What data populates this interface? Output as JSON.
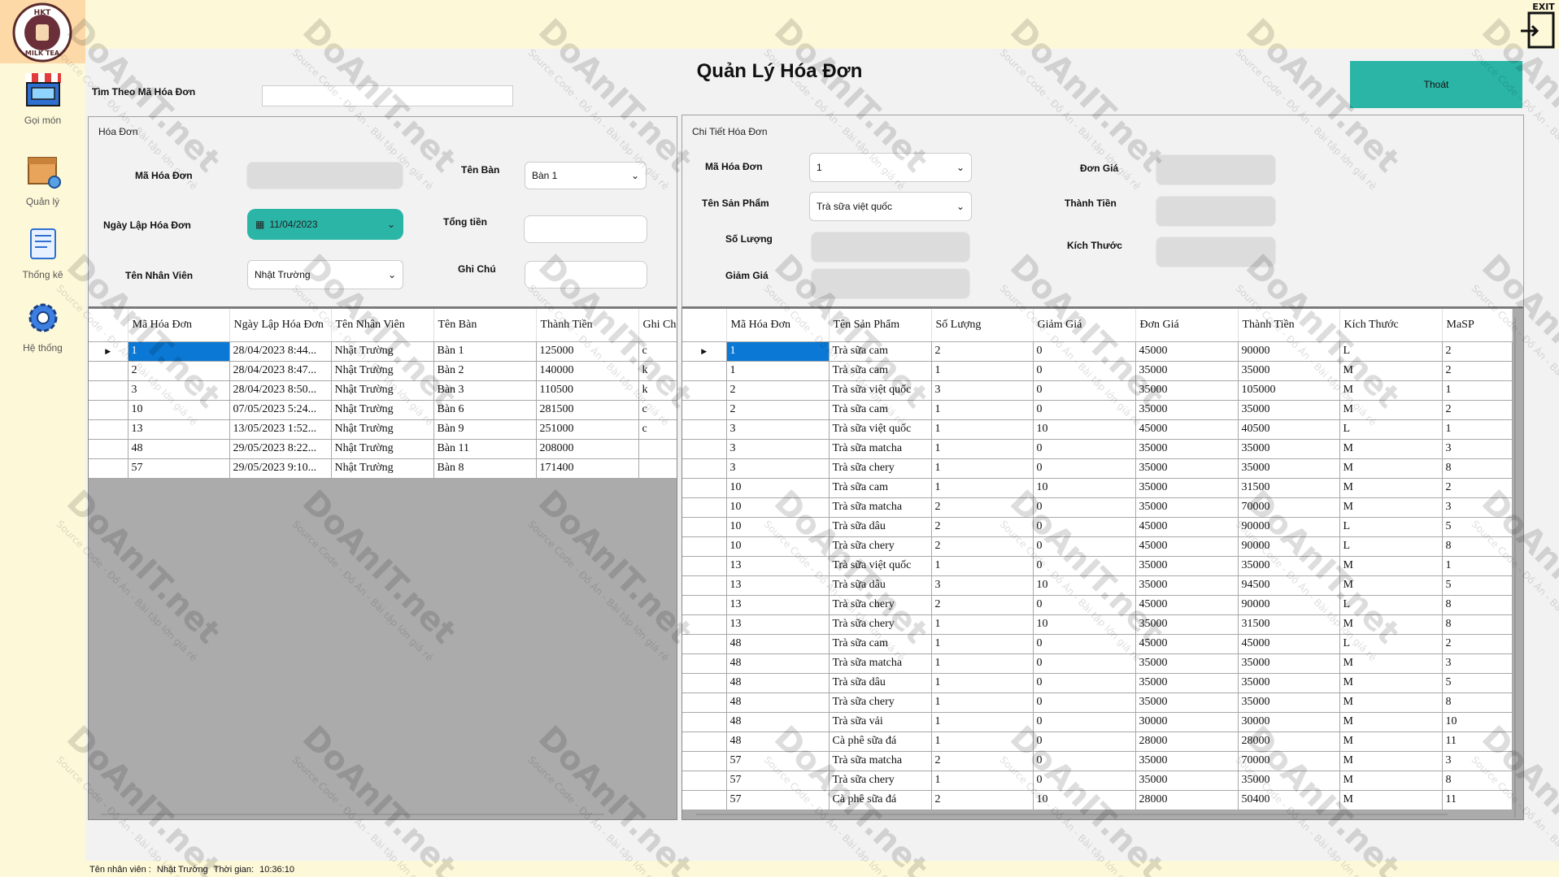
{
  "app": {
    "title": "Quản Lý Hóa Đơn",
    "logo_text": "HKT MILK TEA",
    "exit_icon_label": "EXIT"
  },
  "sidebar": {
    "items": [
      {
        "label": "Gọi món",
        "icon": "shop-icon"
      },
      {
        "label": "Quản lý",
        "icon": "box-gear-icon"
      },
      {
        "label": "Thống kê",
        "icon": "report-icon"
      },
      {
        "label": "Hệ thống",
        "icon": "gear-icon"
      }
    ]
  },
  "search": {
    "label": "Tìm Theo Mã Hóa Đơn",
    "value": ""
  },
  "exit_button": {
    "label": "Thoát"
  },
  "invoice": {
    "group_title": "Hóa Đơn",
    "ma_hoa_don_label": "Mã Hóa Đơn",
    "ma_hoa_don_value": "",
    "ngay_lap_label": "Ngày Lập Hóa Đơn",
    "ngay_lap_value": "11/04/2023",
    "nhan_vien_label": "Tên Nhân Viên",
    "nhan_vien_value": "Nhật Trường",
    "ban_label": "Tên Bàn",
    "ban_value": "Bàn 1",
    "tong_tien_label": "Tổng tiền",
    "tong_tien_value": "",
    "ghi_chu_label": "Ghi Chú",
    "ghi_chu_value": ""
  },
  "detail": {
    "group_title": "Chi Tiết Hóa Đơn",
    "ma_hoa_don_label": "Mã Hóa Đơn",
    "ma_hoa_don_value": "1",
    "san_pham_label": "Tên Sản Phẩm",
    "san_pham_value": "Trà sữa việt quốc",
    "so_luong_label": "Số Lượng",
    "giam_gia_label": "Giảm Giá",
    "don_gia_label": "Đơn Giá",
    "thanh_tien_label": "Thành Tiền",
    "kich_thuoc_label": "Kích Thước"
  },
  "invoice_table": {
    "headers": [
      "Mã Hóa Đơn",
      "Ngày Lập Hóa Đơn",
      "Tên Nhân Viên",
      "Tên Bàn",
      "Thành Tiền",
      "Ghi Ch"
    ],
    "rows": [
      [
        "1",
        "28/04/2023 8:44...",
        "Nhật Trường",
        "Bàn 1",
        "125000",
        "c"
      ],
      [
        "2",
        "28/04/2023 8:47...",
        "Nhật Trường",
        "Bàn 2",
        "140000",
        "k"
      ],
      [
        "3",
        "28/04/2023 8:50...",
        "Nhật Trường",
        "Bàn 3",
        "110500",
        "k"
      ],
      [
        "10",
        "07/05/2023 5:24...",
        "Nhật Trường",
        "Bàn 6",
        "281500",
        "c"
      ],
      [
        "13",
        "13/05/2023 1:52...",
        "Nhật Trường",
        "Bàn 9",
        "251000",
        "c"
      ],
      [
        "48",
        "29/05/2023 8:22...",
        "Nhật Trường",
        "Bàn 11",
        "208000",
        ""
      ],
      [
        "57",
        "29/05/2023 9:10...",
        "Nhật Trường",
        "Bàn 8",
        "171400",
        ""
      ]
    ]
  },
  "detail_table": {
    "headers": [
      "Mã Hóa Đơn",
      "Tên Sản Phẩm",
      "Số Lượng",
      "Giảm Giá",
      "Đơn Giá",
      "Thành Tiền",
      "Kích Thước",
      "MaSP"
    ],
    "rows": [
      [
        "1",
        "Trà sữa cam",
        "2",
        "0",
        "45000",
        "90000",
        "L",
        "2"
      ],
      [
        "1",
        "Trà sữa cam",
        "1",
        "0",
        "35000",
        "35000",
        "M",
        "2"
      ],
      [
        "2",
        "Trà sữa việt quốc",
        "3",
        "0",
        "35000",
        "105000",
        "M",
        "1"
      ],
      [
        "2",
        "Trà sữa cam",
        "1",
        "0",
        "35000",
        "35000",
        "M",
        "2"
      ],
      [
        "3",
        "Trà sữa việt quốc",
        "1",
        "10",
        "45000",
        "40500",
        "L",
        "1"
      ],
      [
        "3",
        "Trà sữa matcha",
        "1",
        "0",
        "35000",
        "35000",
        "M",
        "3"
      ],
      [
        "3",
        "Trà sữa chery",
        "1",
        "0",
        "35000",
        "35000",
        "M",
        "8"
      ],
      [
        "10",
        "Trà sữa cam",
        "1",
        "10",
        "35000",
        "31500",
        "M",
        "2"
      ],
      [
        "10",
        "Trà sữa matcha",
        "2",
        "0",
        "35000",
        "70000",
        "M",
        "3"
      ],
      [
        "10",
        "Trà sữa dâu",
        "2",
        "0",
        "45000",
        "90000",
        "L",
        "5"
      ],
      [
        "10",
        "Trà sữa chery",
        "2",
        "0",
        "45000",
        "90000",
        "L",
        "8"
      ],
      [
        "13",
        "Trà sữa việt quốc",
        "1",
        "0",
        "35000",
        "35000",
        "M",
        "1"
      ],
      [
        "13",
        "Trà sữa dâu",
        "3",
        "10",
        "35000",
        "94500",
        "M",
        "5"
      ],
      [
        "13",
        "Trà sữa chery",
        "2",
        "0",
        "45000",
        "90000",
        "L",
        "8"
      ],
      [
        "13",
        "Trà sữa chery",
        "1",
        "10",
        "35000",
        "31500",
        "M",
        "8"
      ],
      [
        "48",
        "Trà sữa cam",
        "1",
        "0",
        "45000",
        "45000",
        "L",
        "2"
      ],
      [
        "48",
        "Trà sữa matcha",
        "1",
        "0",
        "35000",
        "35000",
        "M",
        "3"
      ],
      [
        "48",
        "Trà sữa dâu",
        "1",
        "0",
        "35000",
        "35000",
        "M",
        "5"
      ],
      [
        "48",
        "Trà sữa chery",
        "1",
        "0",
        "35000",
        "35000",
        "M",
        "8"
      ],
      [
        "48",
        "Trà sữa vải",
        "1",
        "0",
        "30000",
        "30000",
        "M",
        "10"
      ],
      [
        "48",
        "Cà phê sữa đá",
        "1",
        "0",
        "28000",
        "28000",
        "M",
        "11"
      ],
      [
        "57",
        "Trà sữa matcha",
        "2",
        "0",
        "35000",
        "70000",
        "M",
        "3"
      ],
      [
        "57",
        "Trà sữa chery",
        "1",
        "0",
        "35000",
        "35000",
        "M",
        "8"
      ],
      [
        "57",
        "Cà phê sữa đá",
        "2",
        "10",
        "28000",
        "50400",
        "M",
        "11"
      ]
    ]
  },
  "status_bar": {
    "employee_label": "Tên nhân viên :",
    "employee_value": "Nhật Trường",
    "time_label": "Thời gian:",
    "time_value": "10:36:10"
  },
  "colors": {
    "accent": "#2ab5a7",
    "selection": "#0a78d4",
    "background": "#fdf8d8",
    "panel": "#f2f2f2",
    "grid_empty": "#ababab"
  },
  "watermark": {
    "text": "DoAnIT.net",
    "subtext": "Source Code - Đồ Án - Bài tập lớn giá rẻ"
  }
}
